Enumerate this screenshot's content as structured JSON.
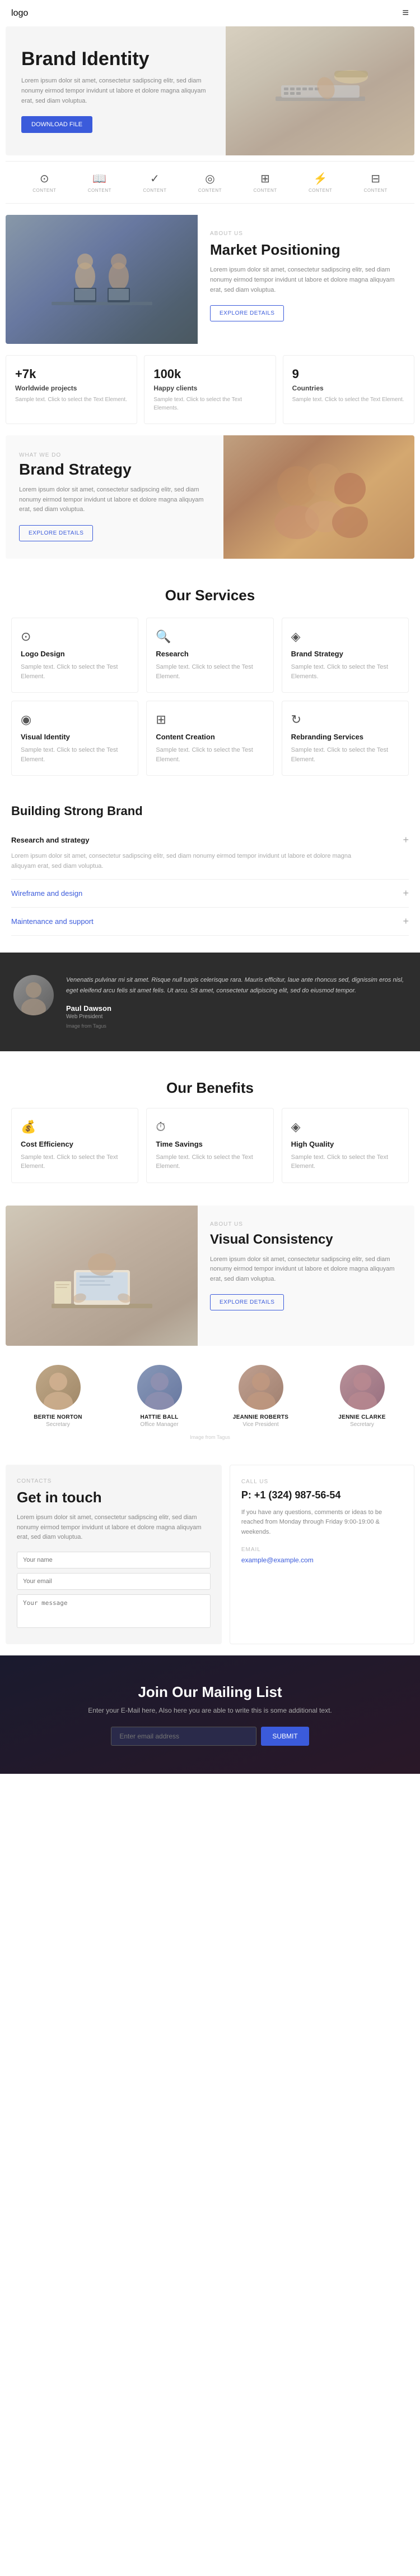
{
  "nav": {
    "logo": "logo",
    "menu_icon": "≡"
  },
  "hero": {
    "title": "Brand Identity",
    "text": "Lorem ipsum dolor sit amet, consectetur sadipscing elitr, sed diam nonumy eirmod tempor invidunt ut labore et dolore magna aliquyam erat, sed diam voluptua.",
    "button": "DOWNLOAD FILE"
  },
  "icons_row": [
    {
      "label": "CONTENT",
      "icon": "⊙"
    },
    {
      "label": "CONTENT",
      "icon": "⊡"
    },
    {
      "label": "CONTENT",
      "icon": "✓"
    },
    {
      "label": "CONTENT",
      "icon": "◎"
    },
    {
      "label": "CONTENT",
      "icon": "⊞"
    },
    {
      "label": "CONTENT",
      "icon": "⚡"
    },
    {
      "label": "CONTENT",
      "icon": "⊟"
    }
  ],
  "market_positioning": {
    "about_label": "ABOUT US",
    "title": "Market Positioning",
    "text": "Lorem ipsum dolor sit amet, consectetur sadipscing elitr, sed diam nonumy eirmod tempor invidunt ut labore et dolore magna aliquyam erat, sed diam voluptua.",
    "button": "EXPLORE DETAILS"
  },
  "stats": [
    {
      "number": "+7k",
      "label": "Worldwide projects",
      "text": "Sample text. Click to select the Text Element."
    },
    {
      "number": "100k",
      "label": "Happy clients",
      "text": "Sample text. Click to select the Text Elements."
    },
    {
      "number": "9",
      "label": "Countries",
      "text": "Sample text. Click to select the Text Element."
    }
  ],
  "brand_strategy": {
    "what_we_do": "WHAT WE DO",
    "title": "Brand Strategy",
    "text": "Lorem ipsum dolor sit amet, consectetur sadipscing elitr, sed diam nonumy eirmod tempor invidunt ut labore et dolore magna aliquyam erat, sed diam voluptua.",
    "button": "EXPLORE DETAILS"
  },
  "services": {
    "title": "Our Services",
    "items": [
      {
        "icon": "⊙",
        "title": "Logo Design",
        "text": "Sample text. Click to select the Test Element."
      },
      {
        "icon": "⊡",
        "title": "Research",
        "text": "Sample text. Click to select the Test Element."
      },
      {
        "icon": "◈",
        "title": "Brand Strategy",
        "text": "Sample text. Click to select the Test Elements."
      },
      {
        "icon": "◉",
        "title": "Visual Identity",
        "text": "Sample text. Click to select the Test Element."
      },
      {
        "icon": "⊞",
        "title": "Content Creation",
        "text": "Sample text. Click to select the Test Element."
      },
      {
        "icon": "◫",
        "title": "Rebranding Services",
        "text": "Sample text. Click to select the Test Element."
      }
    ]
  },
  "building": {
    "title": "Building Strong Brand",
    "accordion": [
      {
        "label": "Research and strategy",
        "open": true,
        "content": "Lorem ipsum dolor sit amet, consectetur sadipscing elitr, sed diam nonumy eirmod tempor invidunt ut labore et dolore magna aliquyam erat, sed diam voluptua.",
        "icon": "+"
      },
      {
        "label": "Wireframe and design",
        "open": false,
        "content": "",
        "icon": "+"
      },
      {
        "label": "Maintenance and support",
        "open": false,
        "content": "",
        "icon": "+"
      }
    ]
  },
  "testimonial": {
    "text": "Venenatis pulvinar mi sit amet. Risque null turpis celerisque rara. Mauris efficitur, laue ante rhoncus sed, dignissim eros nisl, eget eleifend arcu felis sit amet felis. Ut arcu. Sit amet, consectetur adipiscing elit, sed do eiusmod tempor.",
    "name": "Paul Dawson",
    "role": "Web President",
    "source": "Image from Tagus"
  },
  "benefits": {
    "title": "Our Benefits",
    "items": [
      {
        "icon": "⊙",
        "title": "Cost Efficiency",
        "text": "Sample text. Click to select the Text Element."
      },
      {
        "icon": "◷",
        "title": "Time Savings",
        "text": "Sample text. Click to select the Text Element."
      },
      {
        "icon": "◈",
        "title": "High Quality",
        "text": "Sample text. Click to select the Text Element."
      }
    ]
  },
  "visual_consistency": {
    "about_label": "ABOUT US",
    "title": "Visual Consistency",
    "text": "Lorem ipsum dolor sit amet, consectetur sadipscing elitr, sed diam nonumy eirmod tempor invidunt ut labore et dolore magna aliquyam erat, sed diam voluptua.",
    "button": "EXPLORE DETAILS"
  },
  "team": {
    "members": [
      {
        "name": "BERTIE NORTON",
        "role": "Secretary"
      },
      {
        "name": "HATTIE BALL",
        "role": "Office Manager"
      },
      {
        "name": "JEANNIE ROBERTS",
        "role": "Vice President"
      },
      {
        "name": "JENNIE CLARKE",
        "role": "Secretary"
      }
    ],
    "source": "Image from Tagus"
  },
  "contact": {
    "contacts_label": "CONTACTS",
    "title": "Get in touch",
    "text": "Lorem ipsum dolor sit amet, consectetur sadipscing elitr, sed diam nonumy eirmod tempor invidunt ut labore et dolore magna aliquyam erat, sed diam voluptua.",
    "form": {
      "name_placeholder": "Your name",
      "email_placeholder": "Your email",
      "message_placeholder": "Your message"
    },
    "call_us_label": "CALL US",
    "phone": "P: +1 (324) 987-56-54",
    "call_info": "If you have any questions, comments or ideas to be reached from Monday through Friday 9:00-19:00 & weekends.",
    "email_label": "EMAIL",
    "email": "example@example.com"
  },
  "mailing": {
    "title": "Join Our Mailing List",
    "text": "Enter your E-Mail here, Also here you are able to write this is some additional text.",
    "input_placeholder": "Enter email address",
    "button": "SUBMIT"
  }
}
